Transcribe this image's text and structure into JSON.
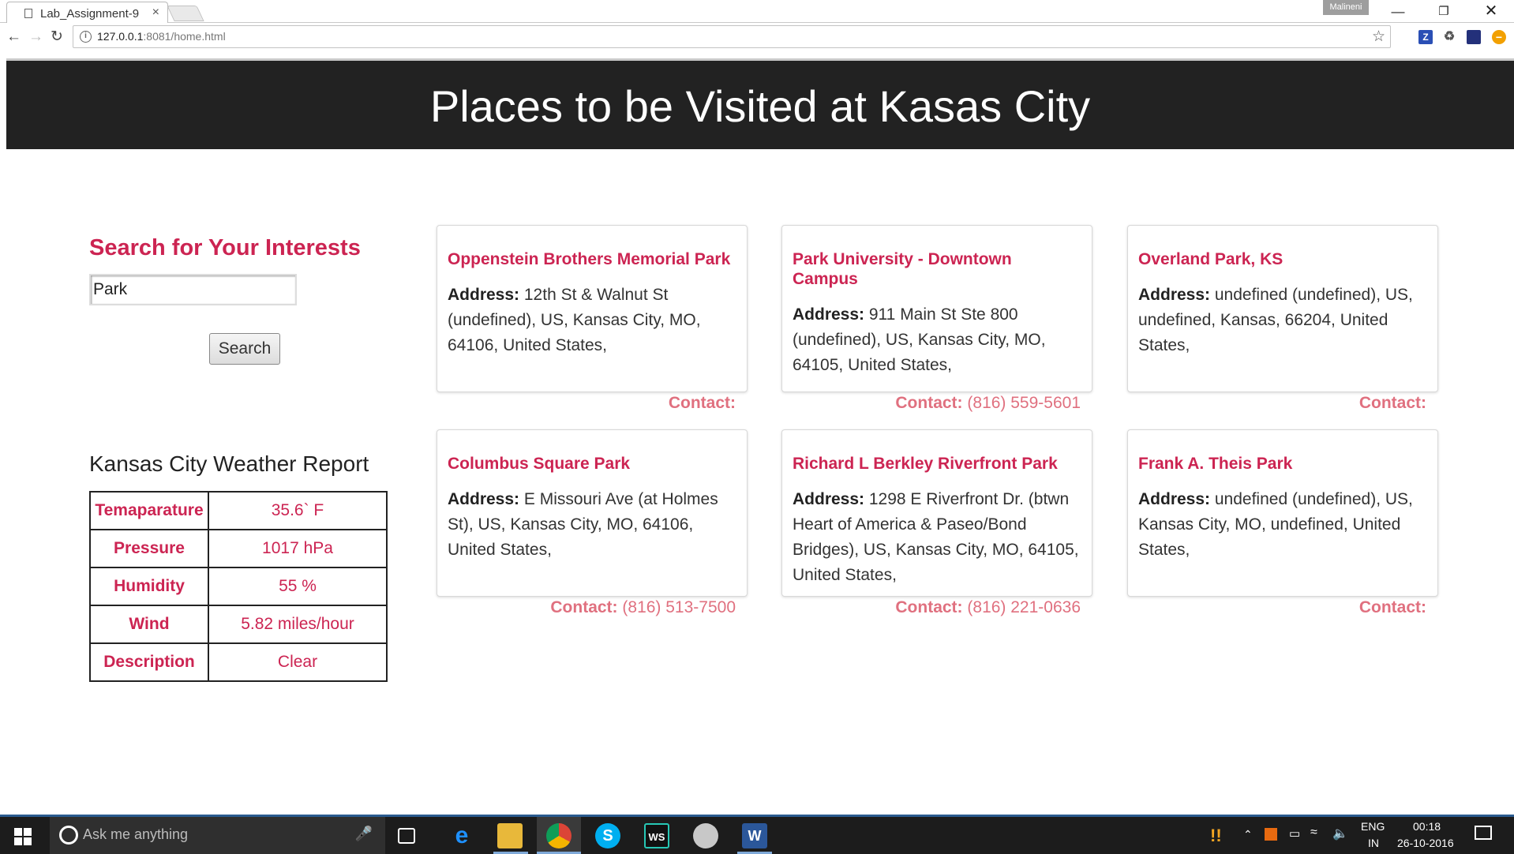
{
  "browser": {
    "tab_title": "Lab_Assignment-9",
    "tab_close": "×",
    "profile_name": "Malineni",
    "url_host": "127.0.0.1",
    "url_rest": ":8081/home.html"
  },
  "page": {
    "header_title": "Places to be Visited at Kasas City",
    "search": {
      "title": "Search for Your Interests",
      "value": "Park",
      "button_label": "Search"
    },
    "weather": {
      "title": "Kansas City Weather Report",
      "rows": [
        {
          "key": "Temaparature",
          "value": "35.6` F"
        },
        {
          "key": "Pressure",
          "value": "1017 hPa"
        },
        {
          "key": "Humidity",
          "value": "55 %"
        },
        {
          "key": "Wind",
          "value": "5.82 miles/hour"
        },
        {
          "key": "Description",
          "value": "Clear"
        }
      ]
    },
    "address_label": "Address:",
    "contact_label": "Contact:",
    "places": [
      {
        "name": "Oppenstein Brothers Memorial Park",
        "address": "12th St & Walnut St (undefined), US, Kansas City, MO, 64106, United States,",
        "phone": ""
      },
      {
        "name": "Park University - Downtown Campus",
        "address": "911 Main St Ste 800 (undefined), US, Kansas City, MO, 64105, United States,",
        "phone": "(816) 559-5601"
      },
      {
        "name": "Overland Park, KS",
        "address": "undefined (undefined), US, undefined, Kansas, 66204, United States,",
        "phone": ""
      },
      {
        "name": "Columbus Square Park",
        "address": "E Missouri Ave (at Holmes St), US, Kansas City, MO, 64106, United States,",
        "phone": "(816) 513-7500"
      },
      {
        "name": "Richard L Berkley Riverfront Park",
        "address": "1298 E Riverfront Dr. (btwn Heart of America & Paseo/Bond Bridges), US, Kansas City, MO, 64105, United States,",
        "phone": "(816) 221-0636"
      },
      {
        "name": "Frank A. Theis Park",
        "address": "undefined (undefined), US, Kansas City, MO, undefined, United States,",
        "phone": ""
      }
    ]
  },
  "taskbar": {
    "search_placeholder": "Ask me anything",
    "lang": "ENG",
    "region": "IN",
    "time": "00:18",
    "date": "26-10-2016",
    "apps": [
      "edge-icon",
      "file-explorer-icon",
      "chrome-icon",
      "skype-icon",
      "webstorm-icon",
      "paint-icon",
      "word-icon"
    ]
  },
  "colors": {
    "accent": "#cc2452",
    "contact": "#e0707f",
    "header_bg": "#222222"
  }
}
